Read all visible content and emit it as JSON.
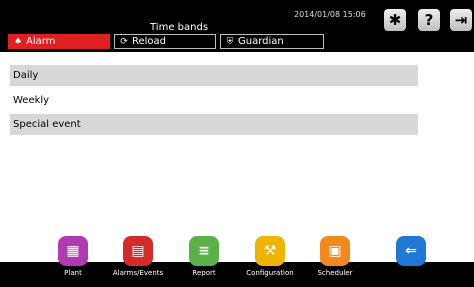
{
  "header": {
    "title": "Time bands",
    "datetime": "2014/01/08 15:06",
    "buttons": [
      {
        "label": "Alarm",
        "icon": "bell-icon",
        "color": "#e02020"
      },
      {
        "label": "Reload",
        "icon": "reload-icon"
      },
      {
        "label": "Guardian",
        "icon": "shield-icon"
      }
    ],
    "icons": [
      "bug-icon",
      "help-icon",
      "exit-icon"
    ]
  },
  "list": {
    "items": [
      {
        "label": "Daily"
      },
      {
        "label": "Weekly"
      },
      {
        "label": "Special event"
      }
    ]
  },
  "nav": {
    "items": [
      {
        "label": "Plant",
        "icon": "plant-icon",
        "color": "#b03ab0"
      },
      {
        "label": "Alarms/Events",
        "icon": "alarm-doc-icon",
        "color": "#d42a2a"
      },
      {
        "label": "Report",
        "icon": "report-icon",
        "color": "#5bb04a"
      },
      {
        "label": "Configuration",
        "icon": "wrench-icon",
        "color": "#f0b400"
      },
      {
        "label": "Scheduler",
        "icon": "calendar-icon",
        "color": "#f08a1e"
      },
      {
        "label": "",
        "icon": "back-arrow-icon",
        "color": "#1e78d6"
      }
    ]
  }
}
